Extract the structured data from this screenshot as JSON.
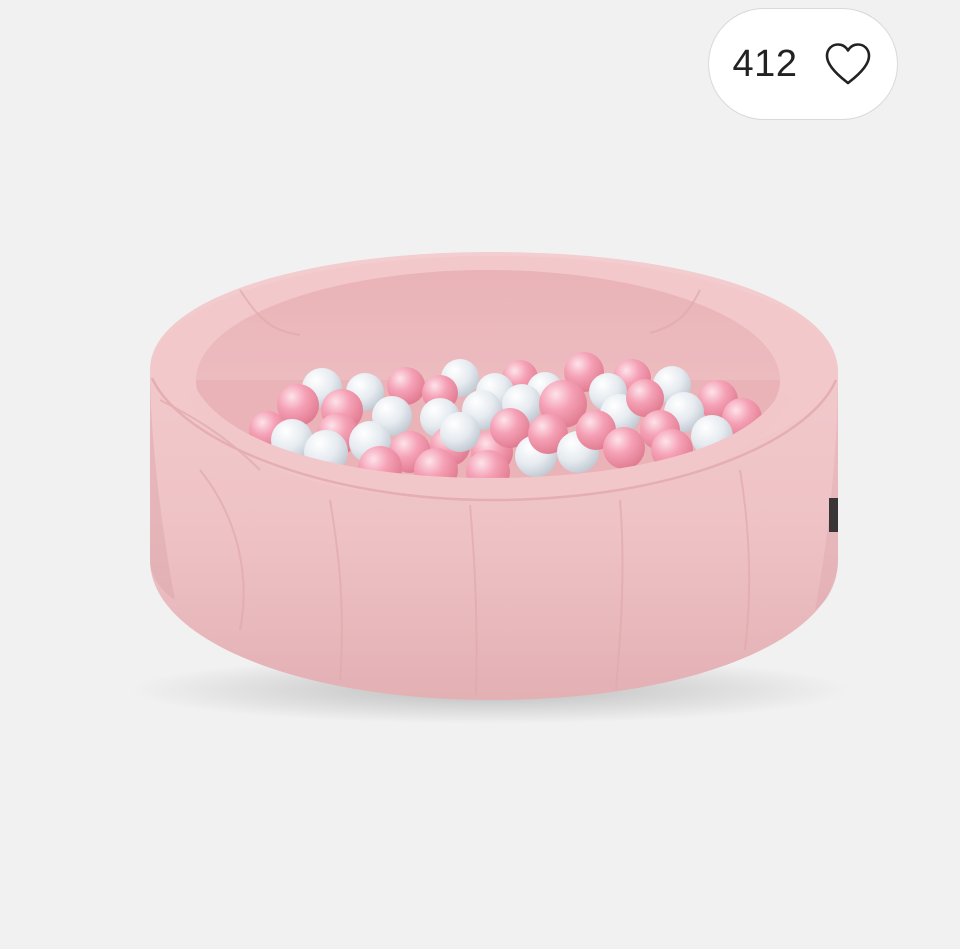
{
  "listing": {
    "image": {
      "subject": "pink-ball-pit-icon",
      "colors": {
        "background": "#f1f1f1",
        "pit_fabric": "#f0c4c6",
        "pit_shadow": "#d89da1",
        "ball_pink": "#f5a1b6",
        "ball_pearl": "#e8edf2"
      }
    },
    "favorite": {
      "count": "412",
      "icon": "heart-outline-icon",
      "color": "#222222"
    }
  }
}
